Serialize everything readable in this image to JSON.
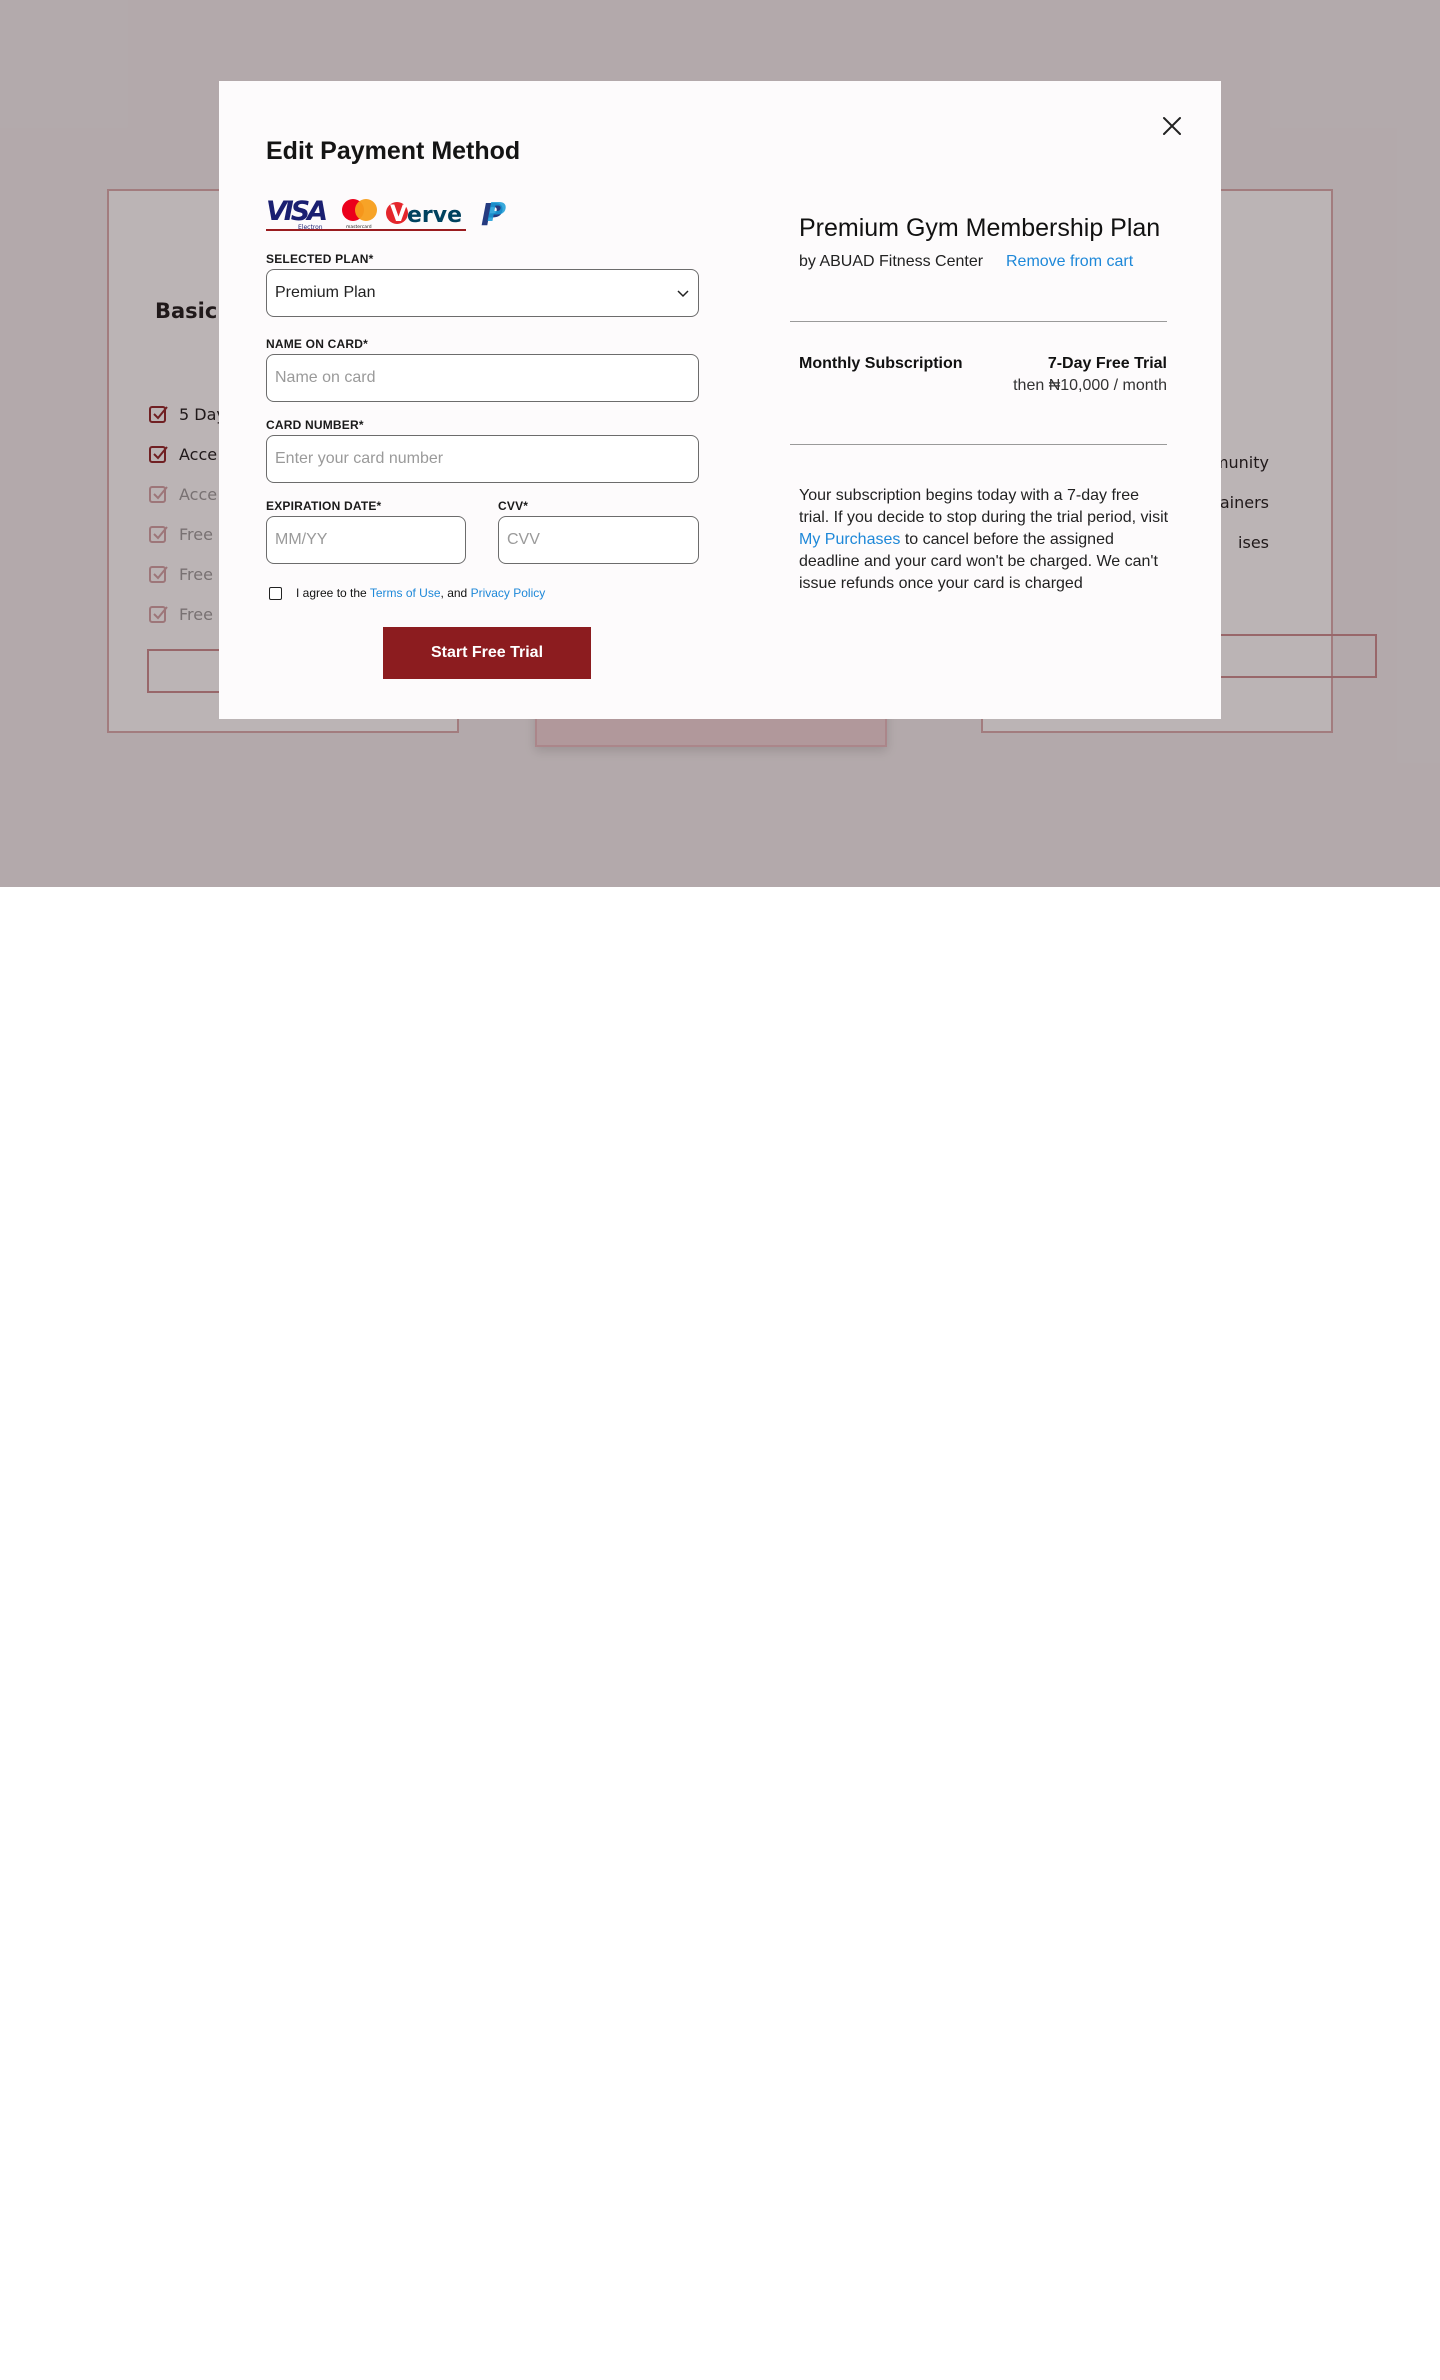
{
  "background": {
    "plans": [
      {
        "title": "Basic P",
        "features": [
          "5 Day",
          "Acce",
          "Acce",
          "Free",
          "Free",
          "Free"
        ]
      },
      {
        "features": [
          "munity",
          "trainers",
          "ises"
        ]
      }
    ]
  },
  "modal": {
    "title": "Edit Payment Method",
    "close_icon": "close-icon",
    "card_logos": [
      "VISA",
      "Electron",
      "mastercard",
      "Verve",
      "PayPal"
    ],
    "form": {
      "plan_label": "SELECTED PLAN*",
      "plan_value": "Premium Plan",
      "name_label": "NAME ON CARD*",
      "name_placeholder": "Name on card",
      "card_label": "CARD NUMBER*",
      "card_placeholder": "Enter your card number",
      "exp_label": "EXPIRATION DATE*",
      "exp_placeholder": "MM/YY",
      "cvv_label": "CVV*",
      "cvv_placeholder": "CVV",
      "agree_prefix": "I agree to the",
      "terms_link": "Terms of Use",
      "agree_mid": ", and",
      "privacy_link": "Privacy Policy",
      "submit_label": "Start Free Trial"
    },
    "summary": {
      "title": "Premium Gym Membership Plan",
      "by": "by ABUAD Fitness Center",
      "remove": "Remove from cart",
      "subscription_name": "Monthly Subscription",
      "trial": "7-Day Free Trial",
      "price": "then ₦10,000 / month",
      "text_1": "Your subscription begins today with a 7-day free trial. If you decide to stop during the trial period, visit",
      "purchases_link": "My Purchases",
      "text_2": "to cancel before the assigned deadline and your card won't be charged. We can't issue refunds once your card is charged"
    }
  },
  "colors": {
    "accent": "#8c1c1f",
    "link": "#1e88d8",
    "overlay": "#b8b0b2"
  }
}
